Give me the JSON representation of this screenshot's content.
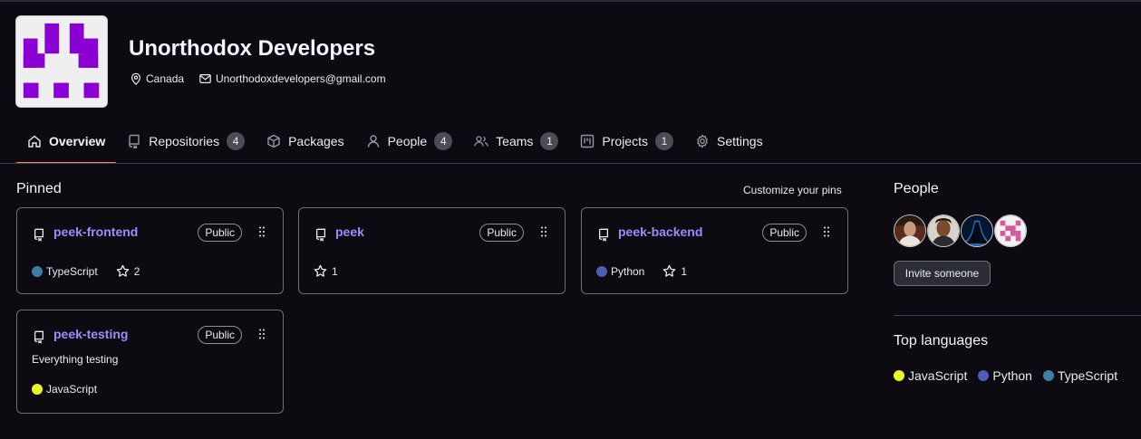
{
  "org": {
    "name": "Unorthodox Developers",
    "location": "Canada",
    "email": "Unorthodoxdevelopers@gmail.com"
  },
  "tabs": [
    {
      "label": "Overview",
      "icon": "home-icon",
      "active": true
    },
    {
      "label": "Repositories",
      "icon": "repo-icon",
      "count": "4"
    },
    {
      "label": "Packages",
      "icon": "package-icon"
    },
    {
      "label": "People",
      "icon": "person-icon",
      "count": "4"
    },
    {
      "label": "Teams",
      "icon": "people-icon",
      "count": "1"
    },
    {
      "label": "Projects",
      "icon": "project-icon",
      "count": "1"
    },
    {
      "label": "Settings",
      "icon": "gear-icon"
    }
  ],
  "pinned": {
    "title": "Pinned",
    "customize_label": "Customize your pins",
    "repos": [
      {
        "name": "peek-frontend",
        "visibility": "Public",
        "language": "TypeScript",
        "language_color": "#3178c6",
        "stars": "2"
      },
      {
        "name": "peek",
        "visibility": "Public",
        "stars": "1"
      },
      {
        "name": "peek-backend",
        "visibility": "Public",
        "language": "Python",
        "language_color": "#3572A5",
        "stars": "1"
      },
      {
        "name": "peek-testing",
        "visibility": "Public",
        "description": "Everything testing",
        "language": "JavaScript",
        "language_color": "#f1e05a"
      }
    ]
  },
  "people": {
    "title": "People",
    "invite_label": "Invite someone"
  },
  "top_languages": {
    "title": "Top languages",
    "items": [
      {
        "name": "JavaScript",
        "color": "#f1e05a"
      },
      {
        "name": "Python",
        "color": "#3572A5"
      },
      {
        "name": "TypeScript",
        "color": "#3178c6"
      }
    ]
  },
  "colors": {
    "accent_link": "#9e8cff",
    "tab_underline": "#f78166",
    "background": "#0d0b11"
  }
}
